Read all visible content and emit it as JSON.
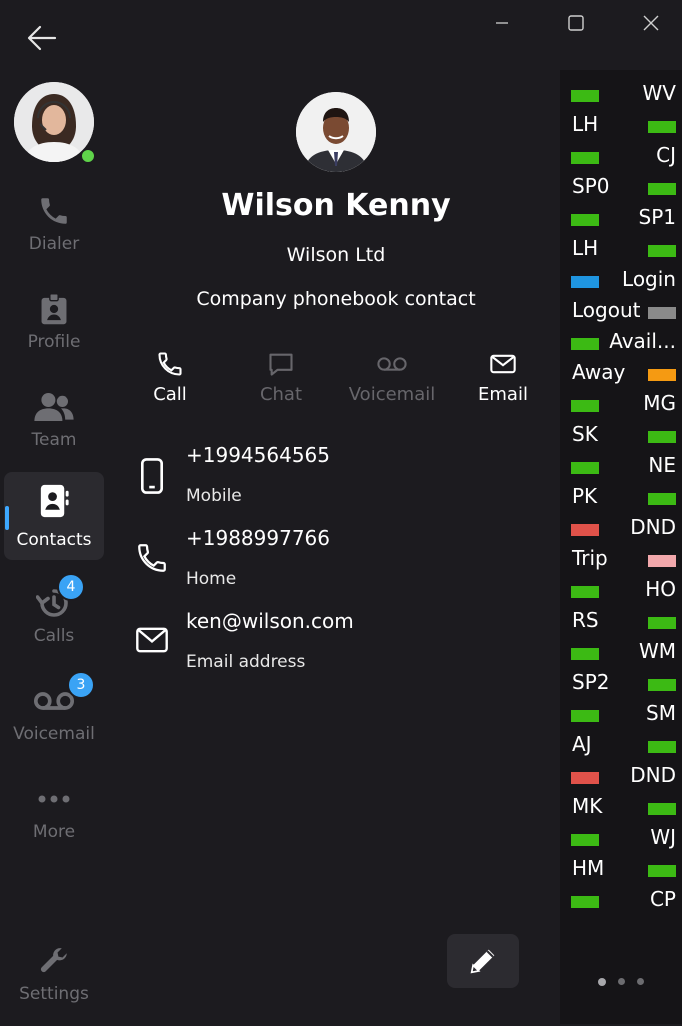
{
  "nav": {
    "items": [
      {
        "label": "Dialer",
        "icon": "phone-icon"
      },
      {
        "label": "Profile",
        "icon": "id-badge-icon"
      },
      {
        "label": "Team",
        "icon": "team-icon"
      },
      {
        "label": "Contacts",
        "icon": "contacts-icon",
        "active": true
      },
      {
        "label": "Calls",
        "icon": "call-history-icon",
        "badge": "4"
      },
      {
        "label": "Voicemail",
        "icon": "voicemail-icon",
        "badge": "3"
      },
      {
        "label": "More",
        "icon": "more-icon"
      },
      {
        "label": "Settings",
        "icon": "wrench-icon"
      }
    ]
  },
  "contact": {
    "name": "Wilson Kenny",
    "company": "Wilson Ltd",
    "type": "Company phonebook contact",
    "actions": [
      {
        "label": "Call",
        "enabled": true
      },
      {
        "label": "Chat",
        "enabled": false
      },
      {
        "label": "Voicemail",
        "enabled": false
      },
      {
        "label": "Email",
        "enabled": true
      }
    ],
    "details": [
      {
        "value": "+1994564565",
        "label": "Mobile",
        "icon": "mobile-icon"
      },
      {
        "value": "+1988997766",
        "label": "Home",
        "icon": "phone-icon"
      },
      {
        "value": "ken@wilson.com",
        "label": "Email address",
        "icon": "envelope-icon"
      }
    ]
  },
  "colors": {
    "green": "#3cba14",
    "blue": "#1f95e0",
    "gray": "#8a8a8a",
    "orange": "#f59a12",
    "red": "#e0524a",
    "pink": "#f2a8ac",
    "badge": "#3aa3f5",
    "presence": "#5fd34a"
  },
  "blf_panel": [
    {
      "label": "WV",
      "color": "green"
    },
    {
      "label": "LH",
      "color": "green"
    },
    {
      "label": "CJ",
      "color": "green"
    },
    {
      "label": "SP0",
      "color": "green"
    },
    {
      "label": "SP1",
      "color": "green"
    },
    {
      "label": "LH",
      "color": "green"
    },
    {
      "label": "Login",
      "color": "blue"
    },
    {
      "label": "Logout",
      "color": "gray"
    },
    {
      "label": "Avail...",
      "color": "green"
    },
    {
      "label": "Away",
      "color": "orange"
    },
    {
      "label": "MG",
      "color": "green"
    },
    {
      "label": "SK",
      "color": "green"
    },
    {
      "label": "NE",
      "color": "green"
    },
    {
      "label": "PK",
      "color": "green"
    },
    {
      "label": "DND",
      "color": "red"
    },
    {
      "label": "Trip",
      "color": "pink"
    },
    {
      "label": "HO",
      "color": "green"
    },
    {
      "label": "RS",
      "color": "green"
    },
    {
      "label": "WM",
      "color": "green"
    },
    {
      "label": "SP2",
      "color": "green"
    },
    {
      "label": "SM",
      "color": "green"
    },
    {
      "label": "AJ",
      "color": "green"
    },
    {
      "label": "DND",
      "color": "red"
    },
    {
      "label": "MK",
      "color": "green"
    },
    {
      "label": "WJ",
      "color": "green"
    },
    {
      "label": "HM",
      "color": "green"
    },
    {
      "label": "CP",
      "color": "green"
    }
  ]
}
